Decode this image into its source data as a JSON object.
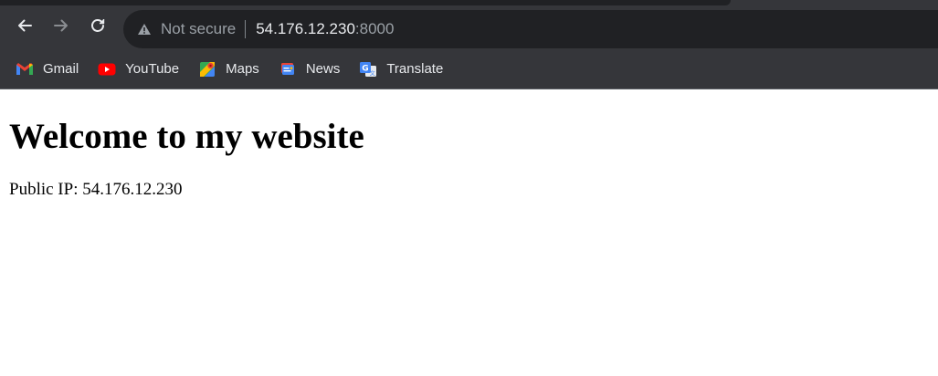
{
  "browser": {
    "omnibox": {
      "security_text": "Not secure",
      "url_host": "54.176.12.230",
      "url_port": ":8000"
    },
    "bookmarks": [
      {
        "label": "Gmail",
        "icon": "gmail-icon"
      },
      {
        "label": "YouTube",
        "icon": "youtube-icon"
      },
      {
        "label": "Maps",
        "icon": "maps-icon"
      },
      {
        "label": "News",
        "icon": "news-icon"
      },
      {
        "label": "Translate",
        "icon": "translate-icon"
      }
    ],
    "colors": {
      "toolbar": "#35363a",
      "omnibox": "#202124",
      "text": "#e8eaed",
      "muted_text": "#9aa0a6"
    }
  },
  "page": {
    "heading": "Welcome to my website",
    "ip_text": "Public IP: 54.176.12.230"
  }
}
